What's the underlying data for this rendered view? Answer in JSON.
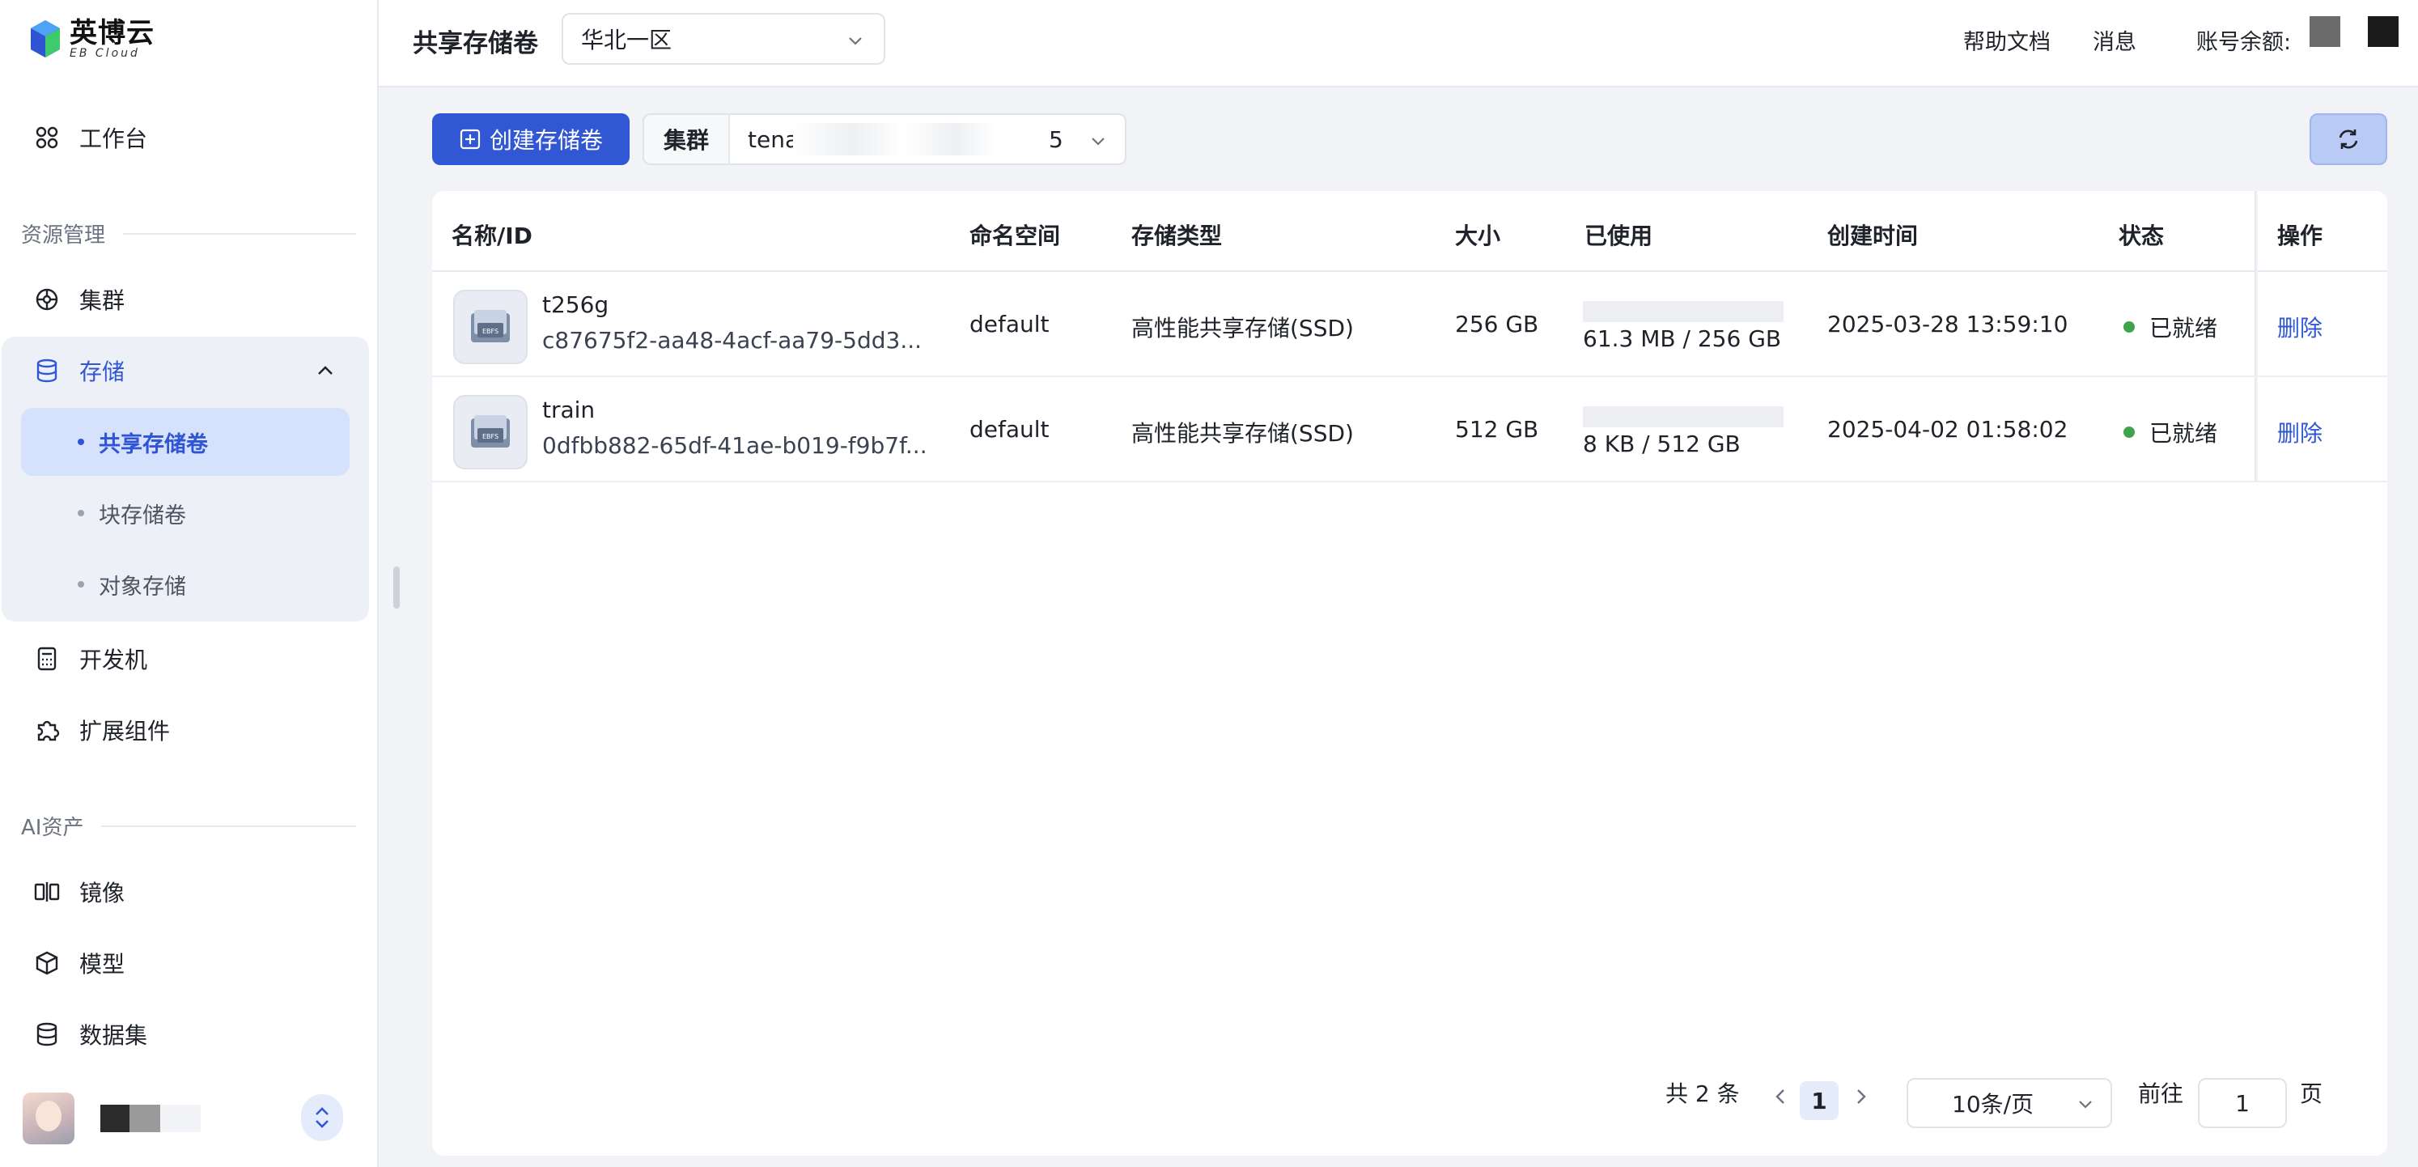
{
  "app": {
    "name": "英博云",
    "subname": "EB Cloud"
  },
  "sidebar": {
    "workbench": "工作台",
    "section_resource": "资源管理",
    "cluster": "集群",
    "storage": "存储",
    "storage_sub": [
      {
        "label": "共享存储卷",
        "active": true
      },
      {
        "label": "块存储卷",
        "active": false
      },
      {
        "label": "对象存储",
        "active": false
      }
    ],
    "devbox": "开发机",
    "extensions": "扩展组件",
    "section_ai": "AI资产",
    "image": "镜像",
    "model": "模型",
    "dataset": "数据集"
  },
  "header": {
    "title": "共享存储卷",
    "region": "华北一区",
    "help_docs": "帮助文档",
    "messages": "消息",
    "balance_label": "账号余额:"
  },
  "toolbar": {
    "create_label": "创建存储卷",
    "cluster_label": "集群",
    "cluster_value_prefix": "tenant-",
    "cluster_value_suffix": "5"
  },
  "table": {
    "columns": [
      "名称/ID",
      "命名空间",
      "存储类型",
      "大小",
      "已使用",
      "创建时间",
      "状态",
      "操作"
    ],
    "rows": [
      {
        "name": "t256g",
        "id": "c87675f2-aa48-4acf-aa79-5dd3...",
        "namespace": "default",
        "type": "高性能共享存储(SSD)",
        "size": "256 GB",
        "used": "61.3 MB / 256 GB",
        "used_fraction": 0.0002,
        "created": "2025-03-28 13:59:10",
        "status": "已就绪",
        "action": "删除"
      },
      {
        "name": "train",
        "id": "0dfbb882-65df-41ae-b019-f9b7f...",
        "namespace": "default",
        "type": "高性能共享存储(SSD)",
        "size": "512 GB",
        "used": "8 KB / 512 GB",
        "used_fraction": 0.0,
        "created": "2025-04-02 01:58:02",
        "status": "已就绪",
        "action": "删除"
      }
    ]
  },
  "pagination": {
    "total_text": "共 2 条",
    "current_page": "1",
    "page_size": "10条/页",
    "goto_label": "前往",
    "goto_value": "1",
    "page_unit": "页"
  },
  "colors": {
    "primary": "#3157d4",
    "status_ready": "#3fa34d",
    "active_bg": "#d6e2fb"
  }
}
